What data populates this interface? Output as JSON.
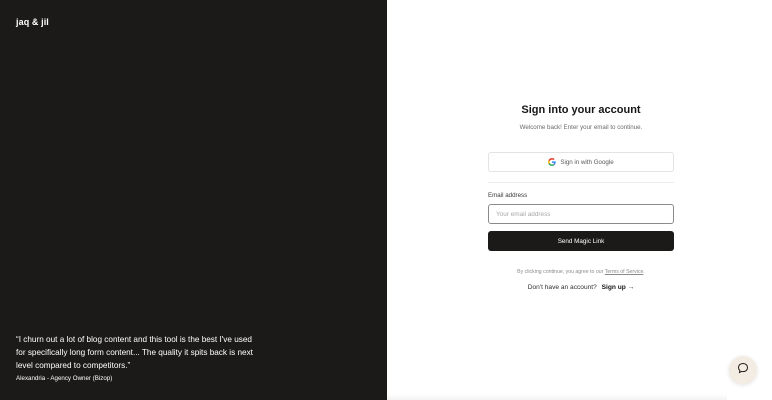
{
  "brand": {
    "name": "jaq & jil"
  },
  "testimonial": {
    "quote": "“I churn out a lot of blog content and this tool is the best I've used for specifically long form content... The quality it spits back is next level compared to competitors.”",
    "author": "Alexandria - Agency Owner (Bizop)"
  },
  "signin": {
    "title": "Sign into your account",
    "subtitle": "Welcome back! Enter your email to continue.",
    "google_button": "Sign in with Google",
    "email_label": "Email address",
    "email_placeholder": "Your email address",
    "email_value": "",
    "send_button": "Send Magic Link",
    "terms_prefix": "By clicking continue, you agree to our ",
    "terms_link": "Terms of Service",
    "terms_suffix": ".",
    "no_account_text": "Don't have an account?",
    "signup_link": "Sign up →"
  },
  "chat": {
    "icon": "chat-bubble-icon"
  },
  "colors": {
    "left_panel_bg": "#1c1a19",
    "primary_button_bg": "#1c1a19",
    "chat_button_bg": "#f3ece3"
  }
}
